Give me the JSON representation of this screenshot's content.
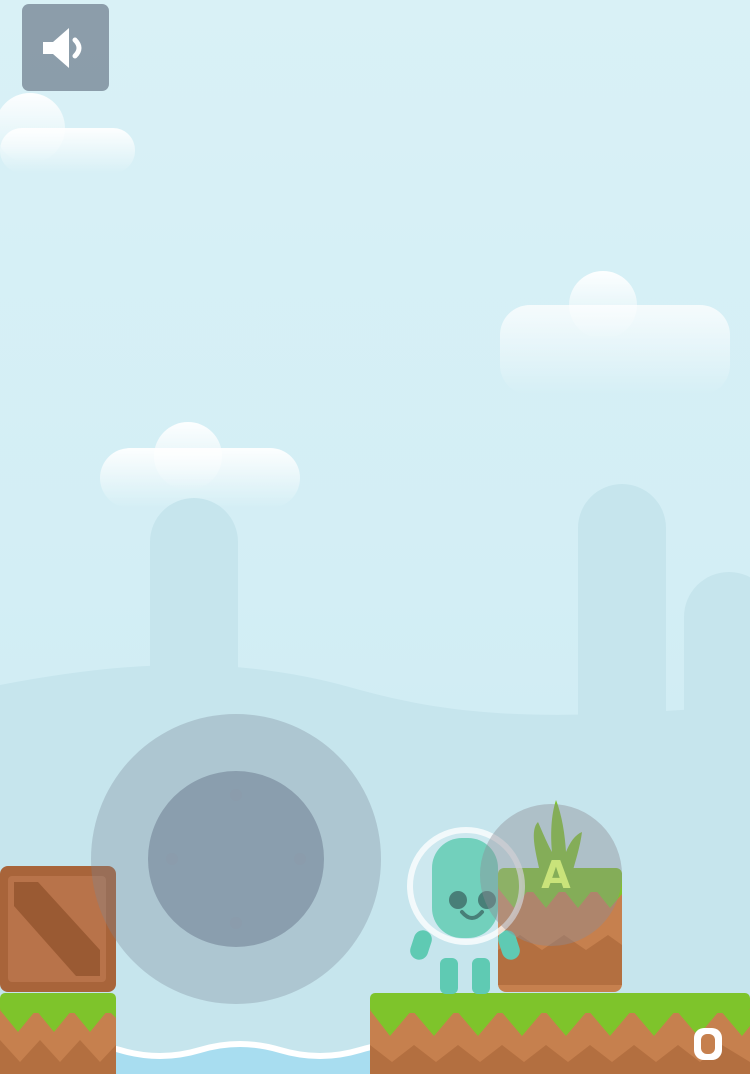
{
  "game": {
    "sound_button_icon": "speaker-icon",
    "action_button_label": "A",
    "joystick_icon": "joystick-knob",
    "fullscreen_icon": "loading-icon"
  },
  "colors": {
    "sky_top": "#d9f1f6",
    "hills": "#c4e5ee",
    "grass": "#7ec42b",
    "dirt": "#c6804e",
    "water": "#9fd8ef",
    "player": "#5fcab3",
    "crate": "#a8643a"
  }
}
